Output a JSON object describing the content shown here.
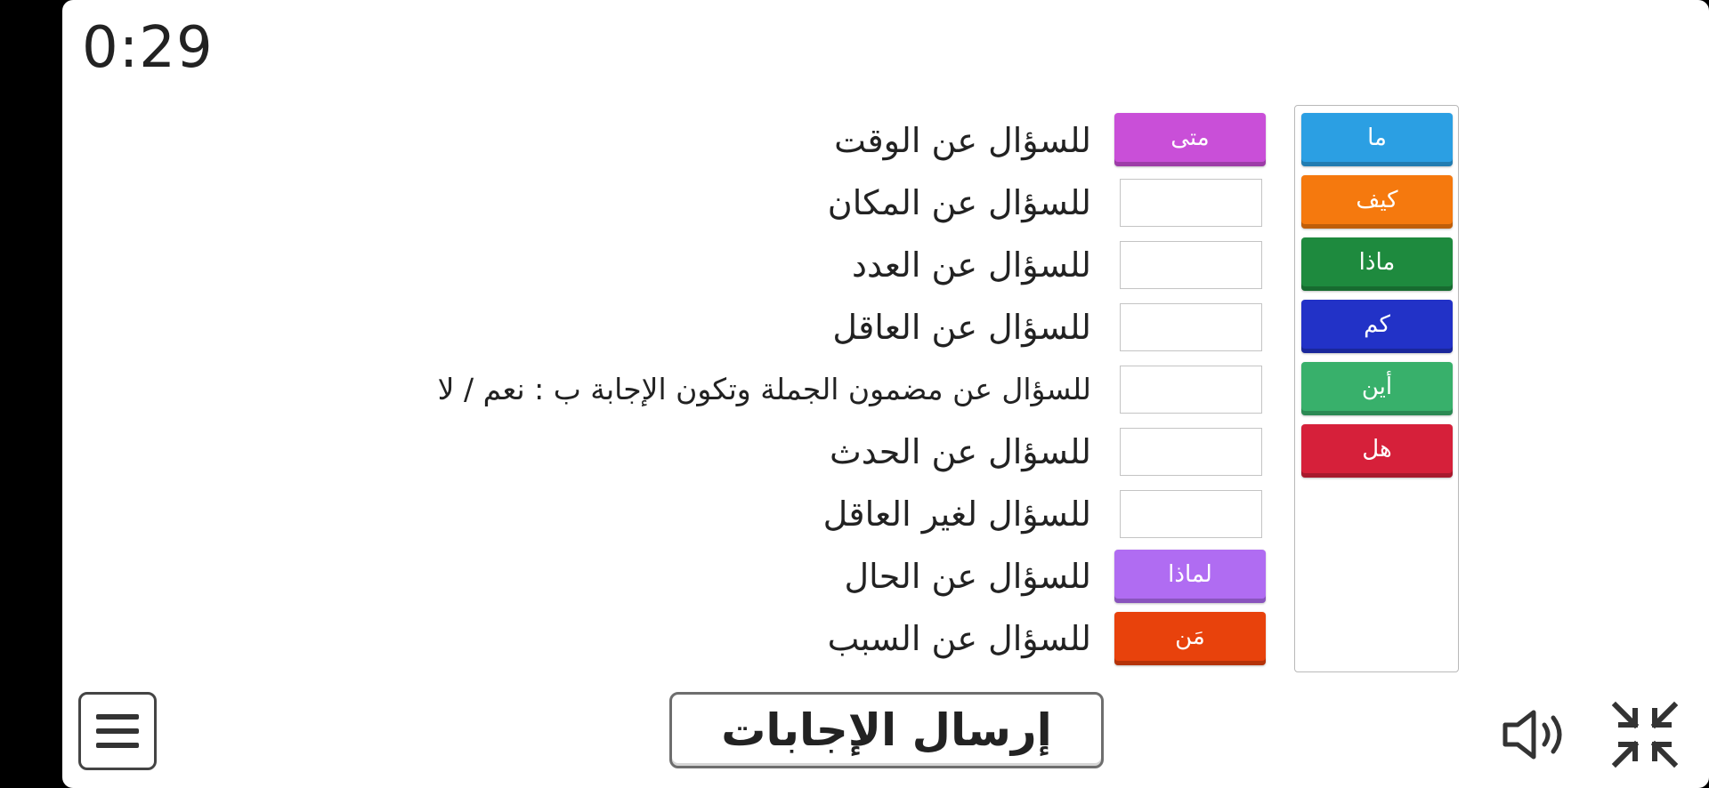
{
  "timer": "0:29",
  "colors": {
    "ma": "#2b9fe3",
    "kayfa": "#f5790e",
    "mathaa": "#1e8a3e",
    "kam": "#2232c7",
    "ayna": "#38b06b",
    "hal": "#d6203a",
    "mata": "#c94fd8",
    "limatha": "#b06cf2",
    "man": "#e8420c"
  },
  "word_bank": [
    {
      "label": "ما"
    },
    {
      "label": "كيف"
    },
    {
      "label": "ماذا"
    },
    {
      "label": "كم"
    },
    {
      "label": "أين"
    },
    {
      "label": "هل"
    }
  ],
  "rows": [
    {
      "clue": "للسؤال عن الوقت",
      "answer": "متى"
    },
    {
      "clue": "للسؤال عن المكان",
      "answer": ""
    },
    {
      "clue": "للسؤال عن العدد",
      "answer": ""
    },
    {
      "clue": "للسؤال عن العاقل",
      "answer": ""
    },
    {
      "clue": "للسؤال عن مضمون الجملة وتكون الإجابة ب : نعم / لا",
      "answer": ""
    },
    {
      "clue": "للسؤال عن الحدث",
      "answer": ""
    },
    {
      "clue": "للسؤال لغير العاقل",
      "answer": ""
    },
    {
      "clue": "للسؤال عن الحال",
      "answer": "لماذا"
    },
    {
      "clue": "للسؤال عن السبب",
      "answer": "مَن"
    }
  ],
  "submit_label": "إرسال الإجابات",
  "icons": {
    "menu": "hamburger-menu-icon",
    "sound": "speaker-icon",
    "fullscreen": "exit-fullscreen-icon"
  }
}
